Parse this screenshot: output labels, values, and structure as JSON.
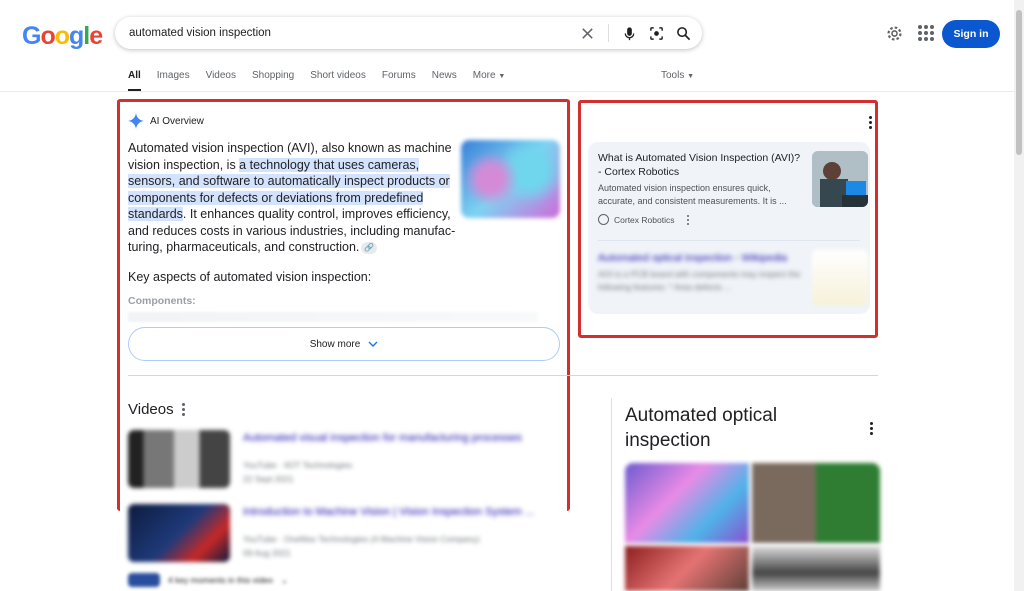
{
  "logo": {
    "letters": [
      "G",
      "o",
      "o",
      "g",
      "l",
      "e"
    ],
    "colors": [
      "#4285F4",
      "#EA4335",
      "#FBBC05",
      "#4285F4",
      "#34A853",
      "#EA4335"
    ]
  },
  "search": {
    "query": "automated vision inspection"
  },
  "header": {
    "signin_label": "Sign in"
  },
  "tabs": [
    "All",
    "Images",
    "Videos",
    "Shopping",
    "Short videos",
    "Forums",
    "News",
    "More"
  ],
  "tools_label": "Tools",
  "ai_overview": {
    "label": "AI Overview",
    "text_before": "Automated vision inspection (AVI), also known as machine vision inspection, is ",
    "text_highlight": "a technology that uses cameras, sensors, and software to automatically inspect products or components for defects or deviations from predefined standards",
    "text_after": ". It enhances quality control, improves efficiency, and reduces costs in various industries, including manufac­turing, pharmaceuticals, and construction.",
    "key_aspects": "Key aspects of automated vision inspection:",
    "components": "Components:",
    "show_more": "Show more"
  },
  "side_card": {
    "title": "What is Automated Vision Inspection (AVI)? - Cortex Robotics",
    "snippet": "Automated vision inspection ensures quick, accurate, and consistent measurements. It is ...",
    "source": "Cortex Robotics",
    "blurred_title": "Automated optical inspection - Wikipedia",
    "blurred_snippet": "AOI is a PCB board with components may inspect the following features: * Area defects ..."
  },
  "videos": {
    "heading": "Videos",
    "items": [
      {
        "title": "Automated visual inspection for manufacturing processes",
        "source": "YouTube · IIOT Technologies",
        "date": "22 Sept 2021"
      },
      {
        "title": "Introduction to Machine Vision | Vision Inspection System ...",
        "source": "YouTube · OneMax Technologies (A Machine Vision Company)",
        "date": "09 Aug 2021"
      }
    ],
    "moments": "4 key moments in this video"
  },
  "knowledge_panel": {
    "title": "Automated optical inspection"
  }
}
